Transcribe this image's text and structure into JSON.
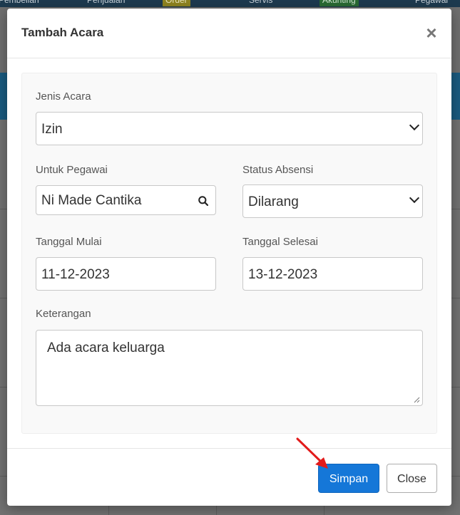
{
  "background_nav": {
    "items": [
      {
        "label": "Pembelian"
      },
      {
        "label": "Penjualan"
      },
      {
        "label": "Order"
      },
      {
        "label": "Servis"
      },
      {
        "label": "Akunting"
      },
      {
        "label": "Pegawai"
      }
    ]
  },
  "modal": {
    "title": "Tambah Acara",
    "close_icon": "times-icon",
    "fields": {
      "jenis_acara": {
        "label": "Jenis Acara",
        "value": "Izin"
      },
      "untuk_pegawai": {
        "label": "Untuk Pegawai",
        "value": "Ni Made Cantika",
        "icon": "search-icon"
      },
      "status_absensi": {
        "label": "Status Absensi",
        "value": "Dilarang"
      },
      "tanggal_mulai": {
        "label": "Tanggal Mulai",
        "value": "11-12-2023"
      },
      "tanggal_selesai": {
        "label": "Tanggal Selesai",
        "value": "13-12-2023"
      },
      "keterangan": {
        "label": "Keterangan",
        "value": "Ada acara keluarga"
      }
    },
    "footer": {
      "save_label": "Simpan",
      "close_label": "Close"
    }
  },
  "colors": {
    "primary": "#1577d8",
    "annotation_arrow": "#e21b1b",
    "overlay": "#6f6f6f"
  }
}
